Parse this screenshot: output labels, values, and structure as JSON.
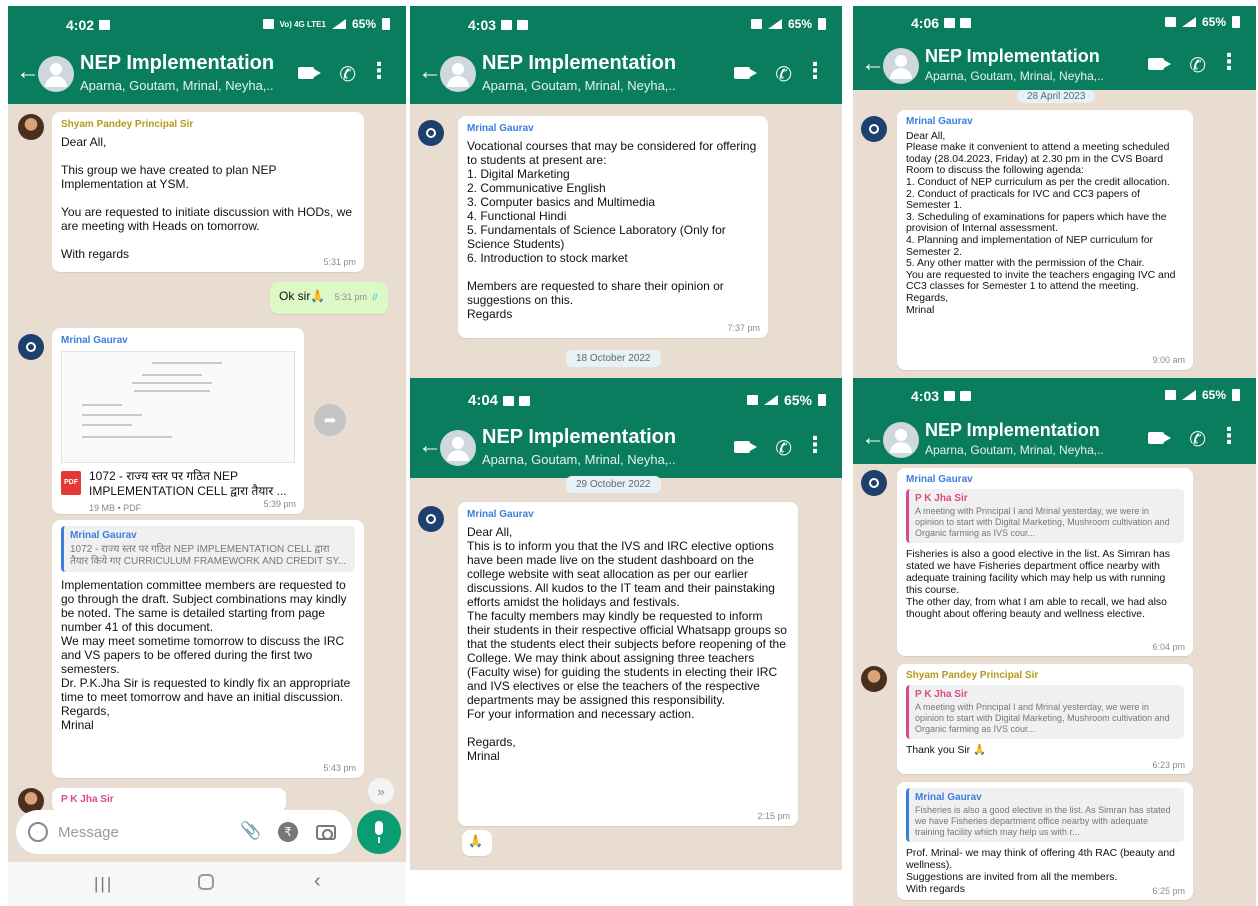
{
  "theme": {
    "header_color": "#0a7d5e",
    "chat_bg": "#e8ddd0",
    "outgoing_bubble": "#dcf8c6",
    "mic_button": "#0a9d73"
  },
  "common": {
    "group_name": "NEP Implementation",
    "members": "Aparna, Goutam, Mrinal, Neyha,..",
    "battery": "65%",
    "signal_text": "Vo) 4G LTE1",
    "icons": [
      "back-arrow-icon",
      "group-avatar-icon",
      "video-call-icon",
      "voice-call-icon",
      "more-options-icon"
    ]
  },
  "screens": [
    {
      "time": "4:02",
      "messages": [
        {
          "sender": "Shyam Pandey Principal Sir",
          "body": "Dear All,\n\nThis group we have created to plan NEP Implementation at YSM.\n\nYou are requested to initiate discussion with HODs, we are meeting with Heads on tomorrow.\n\nWith regards",
          "time": "5:31 pm"
        },
        {
          "outgoing": true,
          "body": "Ok sir",
          "emoji": "🙏",
          "time": "5:31 pm",
          "ticks": "//"
        },
        {
          "sender": "Mrinal Gaurav",
          "document": {
            "name": "1072 - राज्य स्तर पर गठित NEP IMPLEMENTATION CELL द्वारा तैयार ...",
            "meta": "19 MB • PDF",
            "badge": "PDF"
          },
          "time": "5:39 pm"
        },
        {
          "quote": {
            "name": "Mrinal Gaurav",
            "text": "1072 - राज्य स्तर पर गठित NEP IMPLEMENTATION CELL द्वारा तैयार किये गए CURRICULUM FRAMEWORK AND CREDIT SY..."
          },
          "body": "Implementation committee members are requested to go through the draft. Subject combinations may kindly be noted. The same is detailed starting from page number 41 of this document.\nWe may meet sometime tomorrow to discuss the IRC and VS papers to be offered during the first two semesters.\nDr. P.K.Jha Sir is requested to kindly fix an appropriate time to meet tomorrow and have an initial discussion.\nRegards,\nMrinal",
          "time": "5:43 pm"
        },
        {
          "sender": "P K Jha Sir",
          "partial": true
        }
      ],
      "input": {
        "placeholder": "Message"
      }
    },
    {
      "time": "4:03",
      "messages": [
        {
          "sender": "Mrinal Gaurav",
          "body": "Vocational courses that may be considered for offering to students at present are:\n1. Digital Marketing\n2. Communicative English\n3. Computer basics and Multimedia\n4. Functional Hindi\n5. Fundamentals of Science Laboratory (Only for Science  Students)\n6. Introduction to stock market\n\nMembers are requested to share their opinion or suggestions on this.\nRegards",
          "time": "7:37 pm"
        }
      ],
      "date_pill": "18 October 2022"
    },
    {
      "time": "4:04",
      "date_pill": "29 October 2022",
      "messages": [
        {
          "sender": "Mrinal Gaurav",
          "body": "Dear All,\nThis is to inform you that the IVS and IRC elective options have been made live on the student dashboard on the college website with seat allocation as per our earlier discussions. All kudos to the IT team and their painstaking efforts amidst the holidays and festivals.\nThe faculty members may kindly be requested to inform their students in their respective official Whatsapp groups so that the students elect their subjects before reopening of the College. We may think about assigning three teachers (Faculty wise) for guiding the students in electing their IRC and IVS electives or else the teachers of the respective departments may be assigned this responsibility.\nFor your information and necessary action.\n\nRegards,\nMrinal",
          "time": "2:15 pm"
        }
      ],
      "reaction": "🙏"
    },
    {
      "time": "4:06",
      "date_pill": "28 April 2023",
      "messages": [
        {
          "sender": "Mrinal Gaurav",
          "body": "Dear All,\nPlease make it convenient to attend a meeting scheduled today (28.04.2023, Friday) at 2.30 pm in the CVS Board Room to discuss the following agenda:\n1. Conduct of NEP curriculum as per the credit allocation.\n2. Conduct of practicals for IVC and CC3 papers of Semester 1.\n3. Scheduling of examinations for papers which have the provision of Internal assessment.\n4. Planning and implementation of NEP curriculum for Semester 2.\n5. Any other matter with the permission of the Chair.\nYou are requested to invite the teachers engaging IVC and CC3 classes for Semester 1 to attend the meeting.\nRegards,\nMrinal",
          "time": "9:00 am"
        }
      ]
    },
    {
      "time": "4:03",
      "messages": [
        {
          "sender": "Mrinal Gaurav",
          "quote": {
            "name": "P K Jha Sir",
            "text": "A meeting with Principal I and Mrinal  yesterday, we were in opinion to start with  Digital Marketing, Mushroom cultivation and Organic farming as IVS cour..."
          },
          "body": "Fisheries is also a good elective in the list. As Simran has stated we have Fisheries department office nearby with adequate training facility which may help us with running this course.\nThe other day, from what I am able to recall, we had also thought about offering beauty and wellness elective.",
          "time": "6:04 pm"
        },
        {
          "sender": "Shyam Pandey Principal Sir",
          "quote": {
            "name": "P K Jha Sir",
            "text": "A meeting with Principal I and Mrinal  yesterday, we were in opinion to start with  Digital Marketing, Mushroom cultivation and Organic farming as IVS cour..."
          },
          "body": "Thank you Sir",
          "emoji": "🙏",
          "time": "6:23 pm"
        },
        {
          "quote": {
            "name": "Mrinal Gaurav",
            "text": "Fisheries is also a good elective in the list. As Simran has stated we have Fisheries department office nearby with adequate training facility which may help us with r..."
          },
          "body": "Prof. Mrinal- we may think of offering 4th RAC (beauty and wellness).\nSuggestions are invited from all the members.\nWith regards",
          "time": "6:25 pm"
        }
      ]
    }
  ]
}
